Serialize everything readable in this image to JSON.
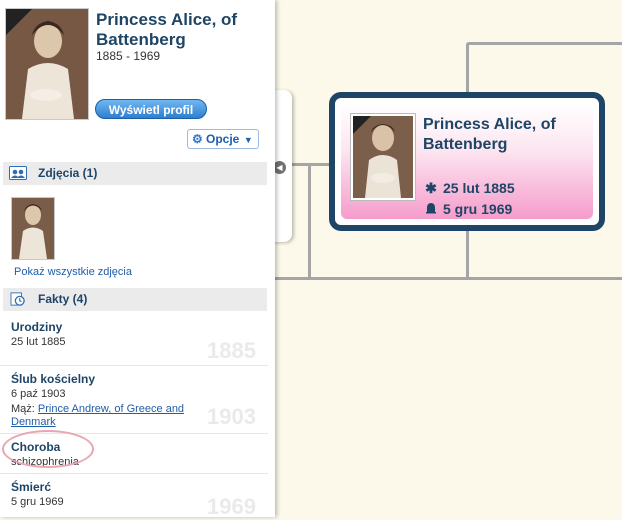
{
  "person": {
    "name": "Princess Alice, of Battenberg",
    "years": "1885 - 1969",
    "view_profile_label": "Wyświetl profil",
    "options_label": "Opcje"
  },
  "photos": {
    "header": "Zdjęcia (1)",
    "show_all_label": "Pokaż wszystkie zdjęcia"
  },
  "facts": {
    "header": "Fakty (4)",
    "items": [
      {
        "title": "Urodziny",
        "date": "25 lut 1885",
        "year": "1885"
      },
      {
        "title": "Ślub kościelny",
        "date": "6 paź 1903",
        "spouse_prefix": "Mąż:",
        "spouse": "Prince Andrew, of Greece and Denmark",
        "year": "1903"
      },
      {
        "title": "Choroba",
        "detail": "schizophrenia"
      },
      {
        "title": "Śmierć",
        "date": "5 gru 1969",
        "year": "1969"
      }
    ]
  },
  "tree_node": {
    "name": "Princess Alice, of Battenberg",
    "birth": "25 lut 1885",
    "death": "5 gru 1969"
  },
  "colors": {
    "accent": "#1e4566",
    "link": "#1f5ea8",
    "node_gradient_end": "#f59ccb",
    "highlight_circle": "#e8a6b3"
  },
  "icons": [
    "ribbon-icon",
    "gear-icon",
    "chevron-down-icon",
    "photos-icon",
    "facts-icon",
    "collapse-arrow-icon",
    "birth-star-icon",
    "death-bell-icon"
  ]
}
